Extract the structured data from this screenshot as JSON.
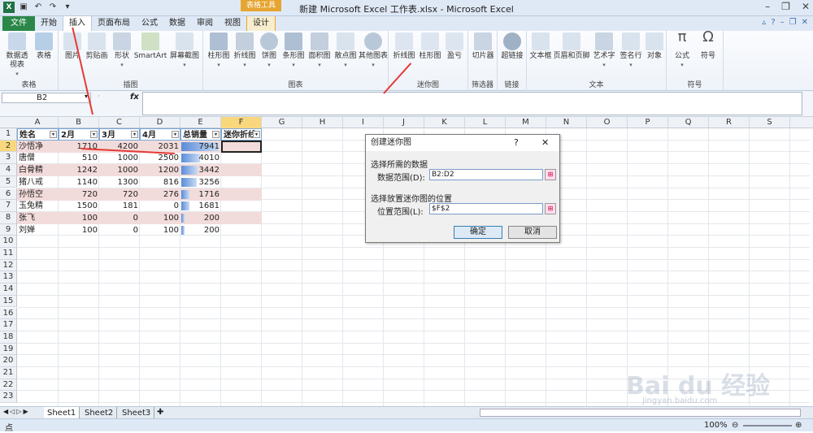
{
  "window": {
    "title": "新建 Microsoft Excel 工作表.xlsx - Microsoft Excel",
    "context_tool": "表格工具"
  },
  "tabs": [
    "文件",
    "开始",
    "插入",
    "页面布局",
    "公式",
    "数据",
    "审阅",
    "视图",
    "设计"
  ],
  "ribbon": {
    "groups": [
      {
        "label": "表格",
        "buttons": [
          "数据透视表",
          "表格"
        ]
      },
      {
        "label": "插图",
        "buttons": [
          "图片",
          "剪贴画",
          "形状",
          "SmartArt",
          "屏幕截图"
        ]
      },
      {
        "label": "图表",
        "buttons": [
          "柱形图",
          "折线图",
          "饼图",
          "条形图",
          "面积图",
          "散点图",
          "其他图表"
        ]
      },
      {
        "label": "迷你图",
        "buttons": [
          "折线图",
          "柱形图",
          "盈亏"
        ]
      },
      {
        "label": "筛选器",
        "buttons": [
          "切片器"
        ]
      },
      {
        "label": "链接",
        "buttons": [
          "超链接"
        ]
      },
      {
        "label": "文本",
        "buttons": [
          "文本框",
          "页眉和页脚",
          "艺术字",
          "签名行",
          "对象"
        ]
      },
      {
        "label": "符号",
        "buttons": [
          "公式",
          "符号"
        ]
      }
    ]
  },
  "formula_bar": {
    "name_box": "B2",
    "fx": "fx",
    "value": ""
  },
  "columns": [
    "A",
    "B",
    "C",
    "D",
    "E",
    "F",
    "G",
    "H",
    "I",
    "J",
    "K",
    "L",
    "M",
    "N",
    "O",
    "P",
    "Q",
    "R",
    "S"
  ],
  "rows": [
    "1",
    "2",
    "3",
    "4",
    "5",
    "6",
    "7",
    "8",
    "9",
    "10",
    "11",
    "12",
    "13",
    "14",
    "15",
    "16",
    "17",
    "18",
    "19",
    "20",
    "21",
    "22",
    "23"
  ],
  "table": {
    "headers": [
      "姓名",
      "2月",
      "3月",
      "4月",
      "总销量",
      "迷你折线"
    ],
    "data": [
      [
        "沙悟净",
        "1710",
        "4200",
        "2031",
        "7941"
      ],
      [
        "唐僧",
        "510",
        "1000",
        "2500",
        "4010"
      ],
      [
        "白骨精",
        "1242",
        "1000",
        "1200",
        "3442"
      ],
      [
        "猪八戒",
        "1140",
        "1300",
        "816",
        "3256"
      ],
      [
        "孙悟空",
        "720",
        "720",
        "276",
        "1716"
      ],
      [
        "玉兔精",
        "1500",
        "181",
        "0",
        "1681"
      ],
      [
        "张飞",
        "100",
        "0",
        "100",
        "200"
      ],
      [
        "刘婵",
        "100",
        "0",
        "100",
        "200"
      ]
    ],
    "bar_fill": [
      1.0,
      0.505,
      0.433,
      0.41,
      0.216,
      0.212,
      0.025,
      0.025
    ]
  },
  "dialog": {
    "title": "创建迷你图",
    "help": "?",
    "close": "✕",
    "section1": "选择所需的数据",
    "data_range_label": "数据范围(D):",
    "data_range_value": "B2:D2",
    "section2": "选择放置迷你图的位置",
    "loc_range_label": "位置范围(L):",
    "loc_range_value": "$F$2",
    "ok": "确定",
    "cancel": "取消"
  },
  "sheets": [
    "Sheet1",
    "Sheet2",
    "Sheet3"
  ],
  "status": {
    "mode": "点",
    "zoom": "100%"
  },
  "watermark": {
    "main": "Bai du 经验",
    "sub": "jingyan.baidu.com"
  },
  "colors": {
    "accent": "#2a8748",
    "header_sel": "#f8d77d",
    "arrow": "#e53935",
    "pink": "#f2dcdb"
  }
}
